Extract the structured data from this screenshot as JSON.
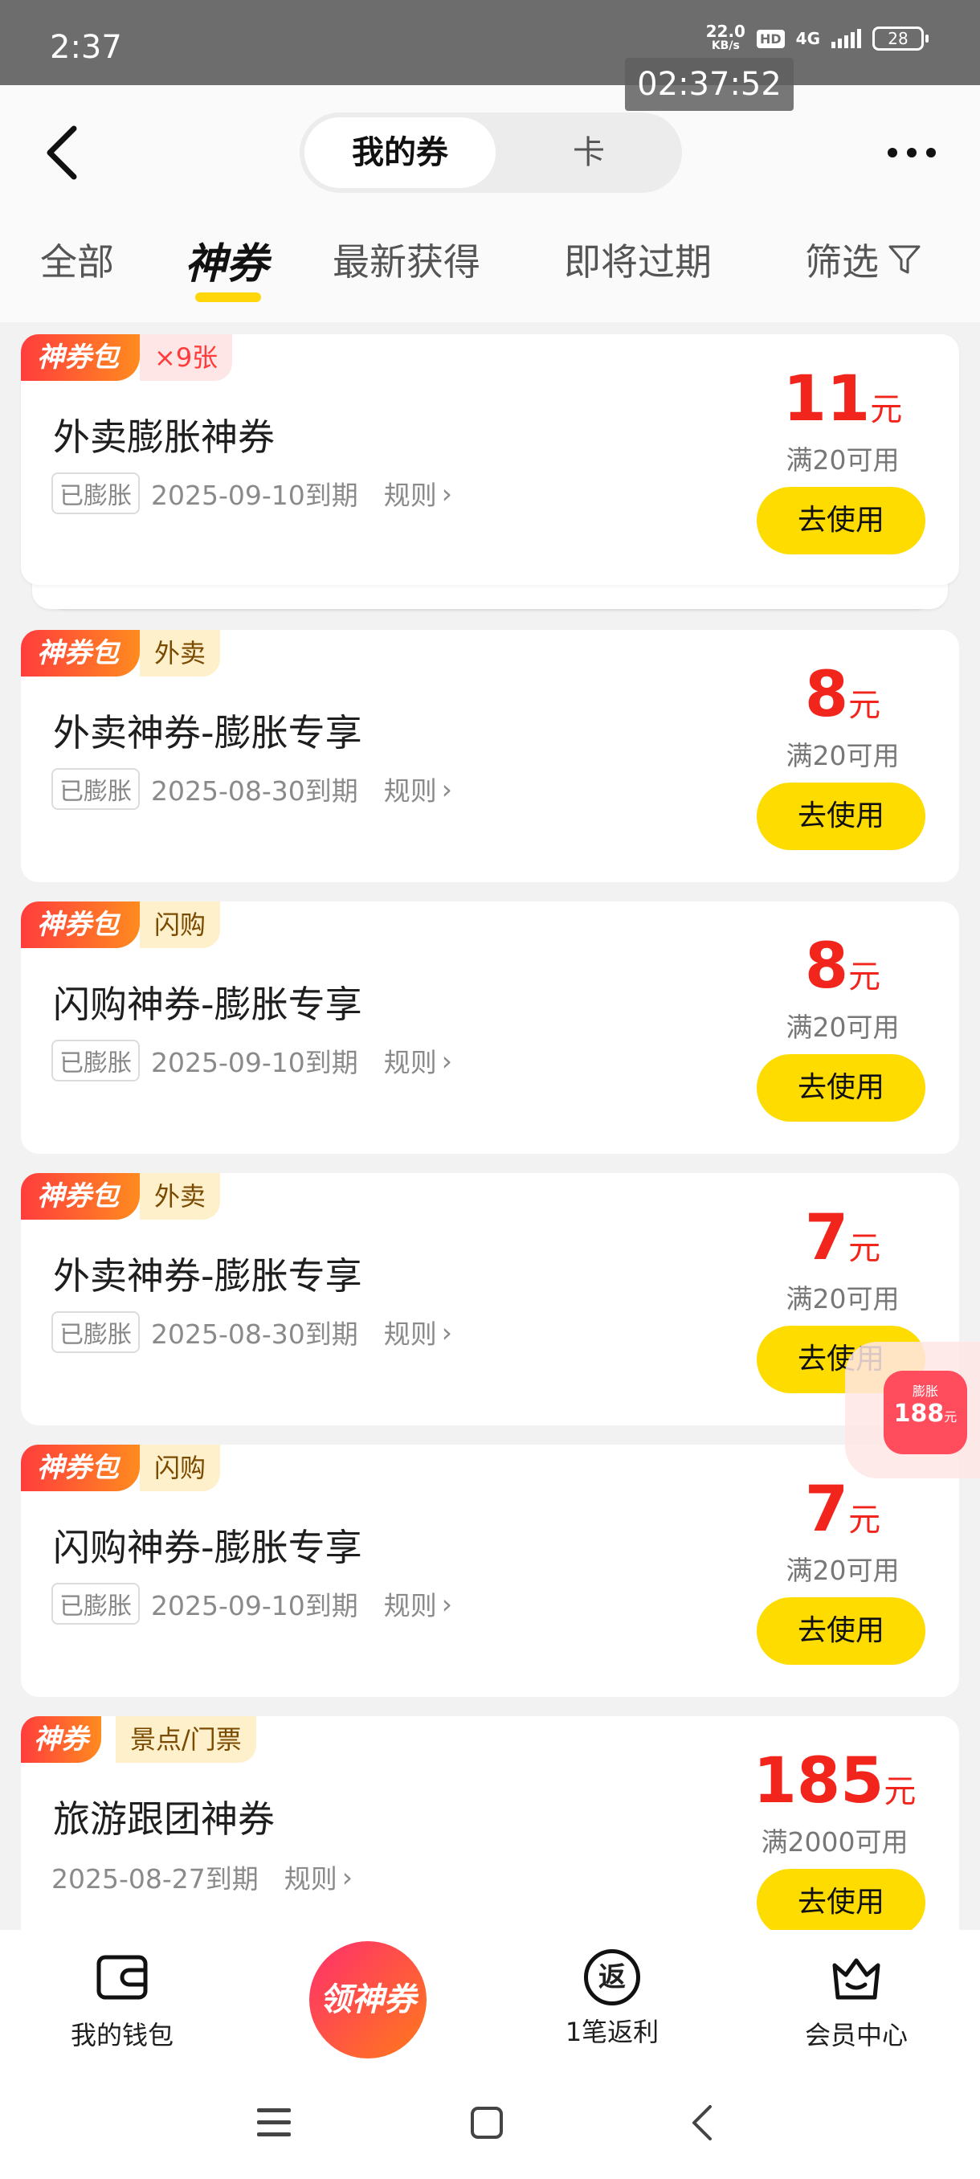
{
  "status_bar": {
    "time": "2:37",
    "net_speed": "22.0",
    "net_unit": "KB/s",
    "hd": "HD",
    "network": "4G",
    "battery": "28"
  },
  "clock_overlay": "02:37:52",
  "header": {
    "segment_active": "我的券",
    "segment_other": "卡"
  },
  "tabs": {
    "all": "全部",
    "shenquan": "神券",
    "latest": "最新获得",
    "expiring": "即将过期",
    "filter": "筛选"
  },
  "coupons": [
    {
      "badge": "神券包",
      "tag": "×9张",
      "title": "外卖膨胀神券",
      "status": "已膨胀",
      "expiry": "2025-09-10到期",
      "rule": "规则",
      "amount": "11",
      "unit": "元",
      "condition": "满20可用",
      "button": "去使用"
    },
    {
      "badge": "神券包",
      "tag": "外卖",
      "title": "外卖神券-膨胀专享",
      "status": "已膨胀",
      "expiry": "2025-08-30到期",
      "rule": "规则",
      "amount": "8",
      "unit": "元",
      "condition": "满20可用",
      "button": "去使用"
    },
    {
      "badge": "神券包",
      "tag": "闪购",
      "title": "闪购神券-膨胀专享",
      "status": "已膨胀",
      "expiry": "2025-09-10到期",
      "rule": "规则",
      "amount": "8",
      "unit": "元",
      "condition": "满20可用",
      "button": "去使用"
    },
    {
      "badge": "神券包",
      "tag": "外卖",
      "title": "外卖神券-膨胀专享",
      "status": "已膨胀",
      "expiry": "2025-08-30到期",
      "rule": "规则",
      "amount": "7",
      "unit": "元",
      "condition": "满20可用",
      "button": "去使用"
    },
    {
      "badge": "神券包",
      "tag": "闪购",
      "title": "闪购神券-膨胀专享",
      "status": "已膨胀",
      "expiry": "2025-09-10到期",
      "rule": "规则",
      "amount": "7",
      "unit": "元",
      "condition": "满20可用",
      "button": "去使用"
    },
    {
      "badge": "神券",
      "tag": "景点/门票",
      "title": "旅游跟团神券",
      "expiry": "2025-08-27到期",
      "rule": "规则",
      "amount": "185",
      "unit": "元",
      "condition": "满2000可用",
      "button": "去使用"
    }
  ],
  "float_ad": {
    "label": "膨胀",
    "amount": "188",
    "unit": "元"
  },
  "bottom_nav": {
    "wallet": "我的钱包",
    "center": "领神券",
    "rebate_icon": "返",
    "rebate": "1笔返利",
    "member": "会员中心"
  },
  "colors": {
    "accent": "#ffdc00",
    "price": "#f2251d",
    "badge_start": "#ff3d3d",
    "badge_end": "#ff8b1f"
  }
}
